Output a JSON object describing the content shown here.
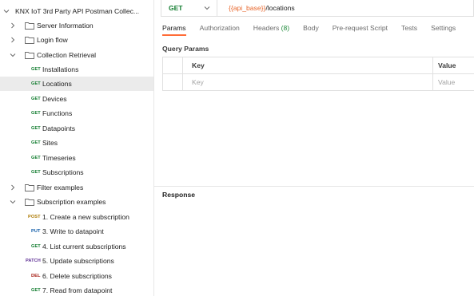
{
  "collection": {
    "title": "KNX IoT 3rd Party API Postman Collec..."
  },
  "sidebar": {
    "folders": {
      "server_information": "Server Information",
      "login_flow": "Login flow",
      "collection_retrieval": "Collection Retrieval",
      "filter_examples": "Filter examples",
      "subscription_examples": "Subscription examples"
    },
    "retrieval_requests": [
      {
        "method": "GET",
        "name": "Installations"
      },
      {
        "method": "GET",
        "name": "Locations"
      },
      {
        "method": "GET",
        "name": "Devices"
      },
      {
        "method": "GET",
        "name": "Functions"
      },
      {
        "method": "GET",
        "name": "Datapoints"
      },
      {
        "method": "GET",
        "name": "Sites"
      },
      {
        "method": "GET",
        "name": "Timeseries"
      },
      {
        "method": "GET",
        "name": "Subscriptions"
      }
    ],
    "subscription_requests": [
      {
        "method": "POST",
        "name": "1. Create a new subscription"
      },
      {
        "method": "PUT",
        "name": "3. Write to datapoint"
      },
      {
        "method": "GET",
        "name": "4. List current subscriptions"
      },
      {
        "method": "PATCH",
        "name": "5. Update subscriptions"
      },
      {
        "method": "DEL",
        "name": "6. Delete subscriptions"
      },
      {
        "method": "GET",
        "name": "7. Read from datapoint"
      }
    ]
  },
  "request": {
    "method": "GET",
    "url_variable": "{{api_base}}",
    "url_path": "/locations"
  },
  "tabs": {
    "params": "Params",
    "authorization": "Authorization",
    "headers": "Headers",
    "headers_count": "(8)",
    "body": "Body",
    "pre_request": "Pre-request Script",
    "tests": "Tests",
    "settings": "Settings"
  },
  "query_params": {
    "title": "Query Params",
    "key_header": "Key",
    "value_header": "Value",
    "key_placeholder": "Key",
    "value_placeholder": "Value"
  },
  "response": {
    "title": "Response"
  },
  "colors": {
    "get": "#0f7b2d",
    "post": "#ad7a03",
    "put": "#0d5aa7",
    "patch": "#623497",
    "delete": "#a61e14",
    "accent": "#ff6c37",
    "url_variable": "#e8662b"
  }
}
